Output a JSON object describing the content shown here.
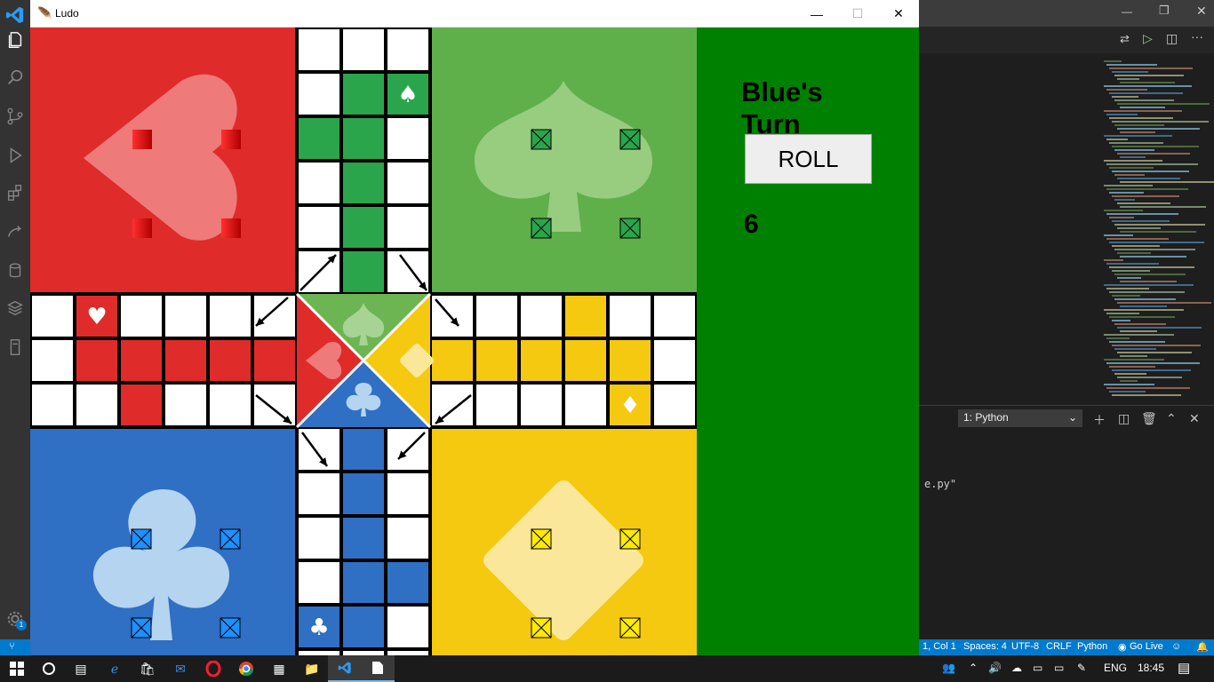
{
  "window": {
    "title": "Ludo",
    "minimize": "—",
    "maximize": "☐",
    "close": "✕"
  },
  "game": {
    "turn_text": "Blue's Turn",
    "roll_label": "ROLL",
    "dice_value": "6"
  },
  "colors": {
    "red": "#e02b2b",
    "green": "#2aa54c",
    "yellow": "#f5c90f",
    "blue": "#2f6fc4",
    "bg": "#008000"
  },
  "vscode": {
    "terminal_select": "1: Python",
    "terminal_text": "e.py\"",
    "status": {
      "position": "1, Col 1",
      "spaces": "Spaces: 4",
      "encoding": "UTF-8",
      "eol": "CRLF",
      "language": "Python",
      "golive": "Go Live",
      "notifications": "1"
    }
  },
  "taskbar": {
    "lang": "ENG",
    "time": "18:45"
  }
}
